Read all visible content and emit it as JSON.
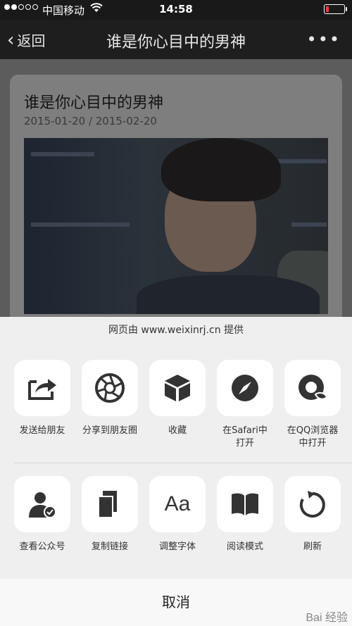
{
  "status_bar": {
    "carrier": "中国移动",
    "time": "14:58"
  },
  "nav": {
    "back_label": "返回",
    "title": "谁是你心目中的男神",
    "more_label": "•••"
  },
  "article": {
    "title": "谁是你心目中的男神",
    "date": "2015-01-20 / 2015-02-20"
  },
  "sheet": {
    "provider": "网页由 www.weixinrj.cn 提供",
    "row1": [
      {
        "label": "发送给朋友",
        "icon": "share-icon"
      },
      {
        "label": "分享到朋友圈",
        "icon": "aperture-icon"
      },
      {
        "label": "收藏",
        "icon": "cube-icon"
      },
      {
        "label": "在Safari中\n打开",
        "icon": "compass-icon"
      },
      {
        "label": "在QQ浏览器\n中打开",
        "icon": "qq-browser-icon"
      }
    ],
    "row2": [
      {
        "label": "查看公众号",
        "icon": "account-icon"
      },
      {
        "label": "复制链接",
        "icon": "copy-icon"
      },
      {
        "label": "调整字体",
        "icon": "font-icon"
      },
      {
        "label": "阅读模式",
        "icon": "book-icon"
      },
      {
        "label": "刷新",
        "icon": "refresh-icon"
      }
    ],
    "cancel_label": "取消"
  },
  "watermark": "Bai 经验"
}
